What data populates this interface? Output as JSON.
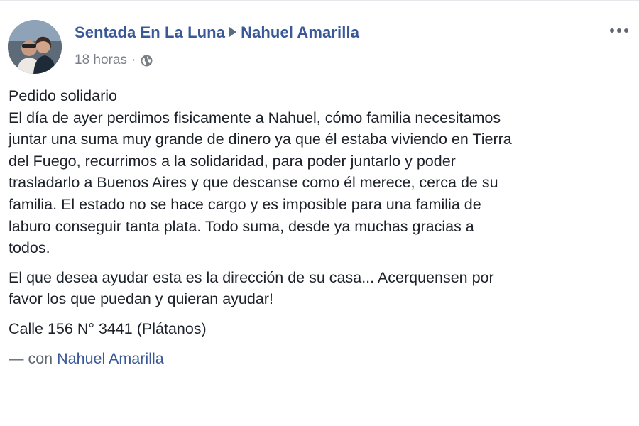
{
  "post": {
    "author": "Sentada En La Luna",
    "recipient": "Nahuel Amarilla",
    "time": "18 horas",
    "separator": "·",
    "privacy_icon": "globe-icon",
    "more_icon": "more-options-icon",
    "paragraphs": [
      [
        "Pedido solidario",
        "El día de ayer perdimos fisicamente a Nahuel, cómo familia necesitamos",
        "juntar una suma muy grande de dinero ya que él estaba viviendo en Tierra",
        "del Fuego, recurrimos a la solidaridad, para poder juntarlo y poder",
        "trasladarlo a Buenos Aires y que descanse como él merece, cerca de su",
        "familia. El estado no se hace cargo y es imposible para una familia de",
        "laburo conseguir tanta plata. Todo suma, desde ya muchas gracias a",
        "todos."
      ],
      [
        "El que desea ayudar esta es la dirección de su casa... Acerquensen por",
        "favor los que puedan y quieran ayudar!"
      ],
      [
        "Calle 156 N° 3441 (Plátanos)"
      ]
    ],
    "with_prefix": "— con",
    "with_name": "Nahuel Amarilla",
    "colors": {
      "link": "#385898",
      "text": "#1d2129",
      "meta": "#7a7f87"
    }
  }
}
